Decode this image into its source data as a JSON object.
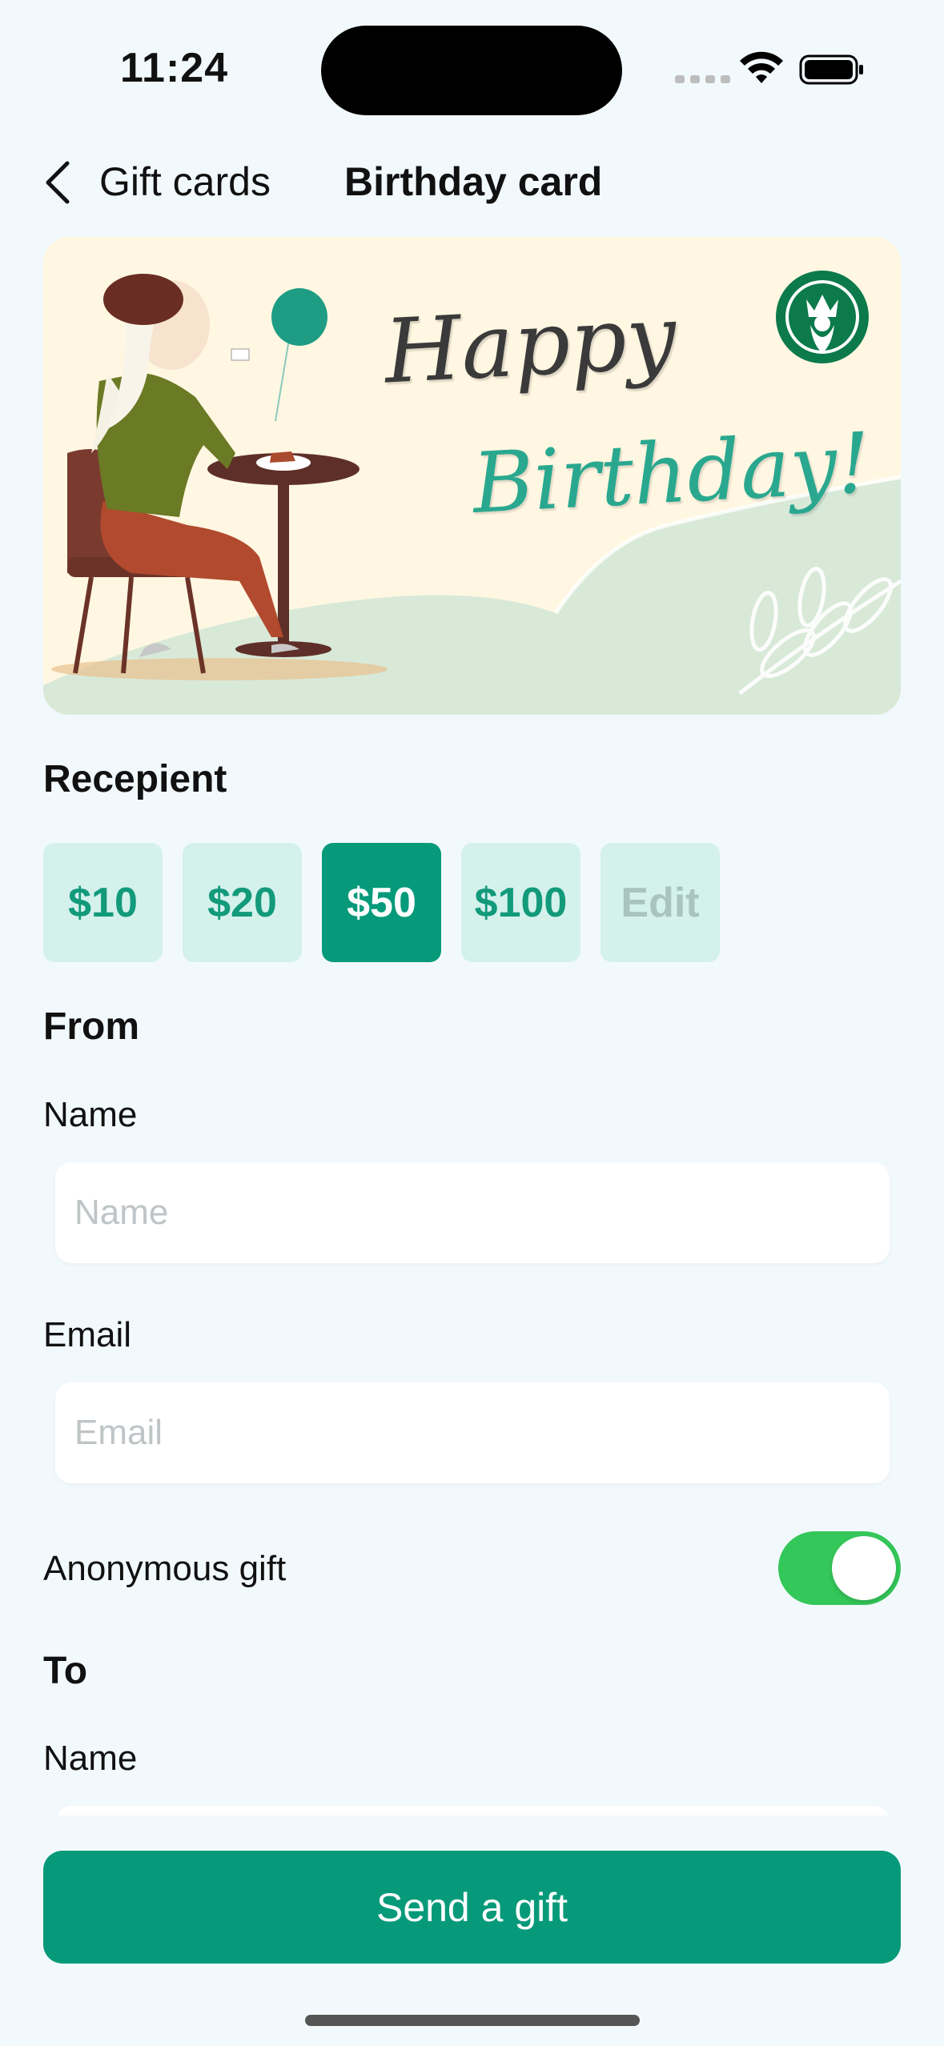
{
  "status_bar": {
    "time": "11:24"
  },
  "nav": {
    "back_label": "Gift cards",
    "title": "Birthday card"
  },
  "card": {
    "line1": "Happy",
    "line2": "Birthday!"
  },
  "recipient_section": {
    "heading": "Recepient",
    "amounts": [
      "$10",
      "$20",
      "$50",
      "$100"
    ],
    "selected_amount": "$50",
    "edit_label": "Edit"
  },
  "from_section": {
    "heading": "From",
    "name_label": "Name",
    "name_placeholder": "Name",
    "name_value": "",
    "email_label": "Email",
    "email_placeholder": "Email",
    "email_value": "",
    "anonymous_label": "Anonymous gift",
    "anonymous_enabled": true
  },
  "to_section": {
    "heading": "To",
    "name_label": "Name"
  },
  "send_button": {
    "label": "Send a gift"
  },
  "colors": {
    "accent": "#079A7A",
    "chip_bg": "#D4F1EC",
    "toggle_on": "#34C759",
    "background": "#F2F9FD"
  },
  "icons": [
    "chevron-left-icon",
    "wifi-icon",
    "battery-icon",
    "cellular-signal-icon",
    "starbucks-logo"
  ]
}
